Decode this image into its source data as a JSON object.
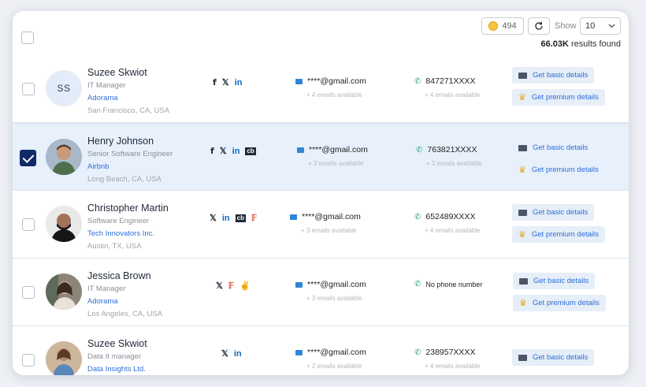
{
  "toolbar": {
    "credits": "494",
    "show_label": "Show",
    "show_value": "10",
    "results_count": "66.03K",
    "results_text": " results found"
  },
  "rows": [
    {
      "name": "Suzee Skwiot",
      "title": "IT Manager",
      "company": "Adorama",
      "location": "San Francisco, CA, USA",
      "initials": "SS",
      "email": "****@gmail.com",
      "email_sub": "+ 4 emails available",
      "phone": "847271XXXX",
      "phone_sub": "+ 4 emails available",
      "basic_label": "Get basic details",
      "premium_label": "Get premium details",
      "selected": false
    },
    {
      "name": "Henry Johnson",
      "title": "Senior Software Engineer",
      "company": "Airbnb",
      "location": "Long Beach, CA, USA",
      "email": "****@gmail.com",
      "email_sub": "+ 3 emails available",
      "phone": "763821XXXX",
      "phone_sub": "+ 3 emails available",
      "basic_label": "Get basic details",
      "premium_label": "Get premium details",
      "selected": true
    },
    {
      "name": "Christopher Martin",
      "title": "Software Engineer",
      "company": "Tech Innovators Inc.",
      "location": "Austin, TX, USA",
      "email": "****@gmail.com",
      "email_sub": "+ 3 emails available",
      "phone": "652489XXXX",
      "phone_sub": "+ 4 emails available",
      "basic_label": "Get basic details",
      "premium_label": "Get premium details",
      "selected": false
    },
    {
      "name": "Jessica Brown",
      "title": "IT Manager",
      "company": "Adorama",
      "location": "Los Angeles, CA, USA",
      "email": "****@gmail.com",
      "email_sub": "+ 3 emails available",
      "phone": "No phone number",
      "phone_sub": "",
      "basic_label": "Get basic details",
      "premium_label": "Get premium details",
      "selected": false
    },
    {
      "name": "Suzee Skwiot",
      "title": "Data It manager",
      "company": "Data Insights Ltd.",
      "location": "",
      "email": "****@gmail.com",
      "email_sub": "+ 2 emails available",
      "phone": "238957XXXX",
      "phone_sub": "+ 4 emails available",
      "basic_label": "Get basic details",
      "premium_label": "",
      "selected": false
    }
  ],
  "colors": {
    "accent": "#2f6fd6",
    "selected_bg": "#e7f0fb",
    "checkbox_checked": "#0f2a66"
  }
}
